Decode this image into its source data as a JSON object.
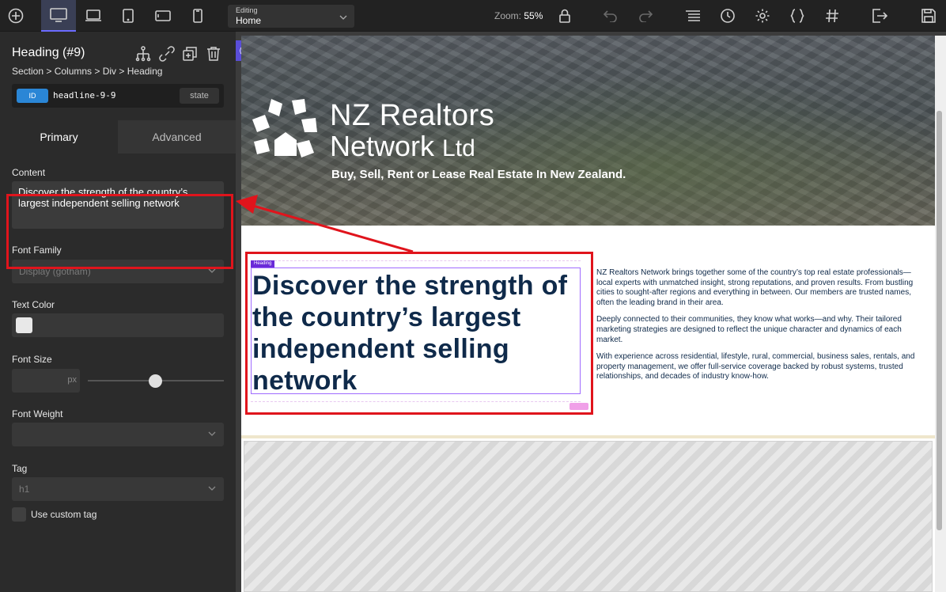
{
  "toolbar": {
    "editing_label": "Editing",
    "editing_value": "Home",
    "zoom_label": "Zoom:",
    "zoom_value": "55%"
  },
  "panel": {
    "element_title": "Heading (#9)",
    "breadcrumb": "Section > Columns > Div > Heading",
    "id_badge": "ID",
    "id_value": "headline-9-9",
    "state_label": "state",
    "tabs": [
      {
        "label": "Primary"
      },
      {
        "label": "Advanced"
      }
    ],
    "content_label": "Content",
    "content_value": "Discover the strength of the country’s largest independent selling network",
    "font_family_label": "Font Family",
    "font_family_value": "Display (gotham)",
    "text_color_label": "Text Color",
    "text_color_value": "#e8e8e8",
    "font_size_label": "Font Size",
    "font_size_unit": "px",
    "font_weight_label": "Font Weight",
    "tag_label": "Tag",
    "tag_value": "h1",
    "custom_tag_label": "Use custom tag"
  },
  "canvas": {
    "brand_line1": "NZ Realtors",
    "brand_line2": "Network",
    "brand_suffix": "Ltd",
    "tagline": "Buy, Sell, Rent or Lease Real Estate In New Zealand.",
    "heading_tag": "Heading",
    "heading": "Discover the strength of the country’s largest independent selling network",
    "paragraphs": [
      "NZ Realtors Network brings together some of the country’s top real estate professionals—local experts with unmatched insight, strong reputations, and proven results. From bustling cities to sought-after regions and everything in between. Our members are trusted names, often the leading brand in their area.",
      "Deeply connected to their communities, they know what works—and why. Their tailored marketing strategies are designed to reflect the unique character and dynamics of each market.",
      "With experience across residential, lifestyle, rural, commercial, business sales, rentals, and property management, we offer full-service coverage backed by robust systems, trusted relationships, and decades of industry know-how."
    ]
  },
  "colors": {
    "accent": "#6b6bff",
    "highlight_red": "#e0141c",
    "heading_navy": "#0f2a4a"
  }
}
